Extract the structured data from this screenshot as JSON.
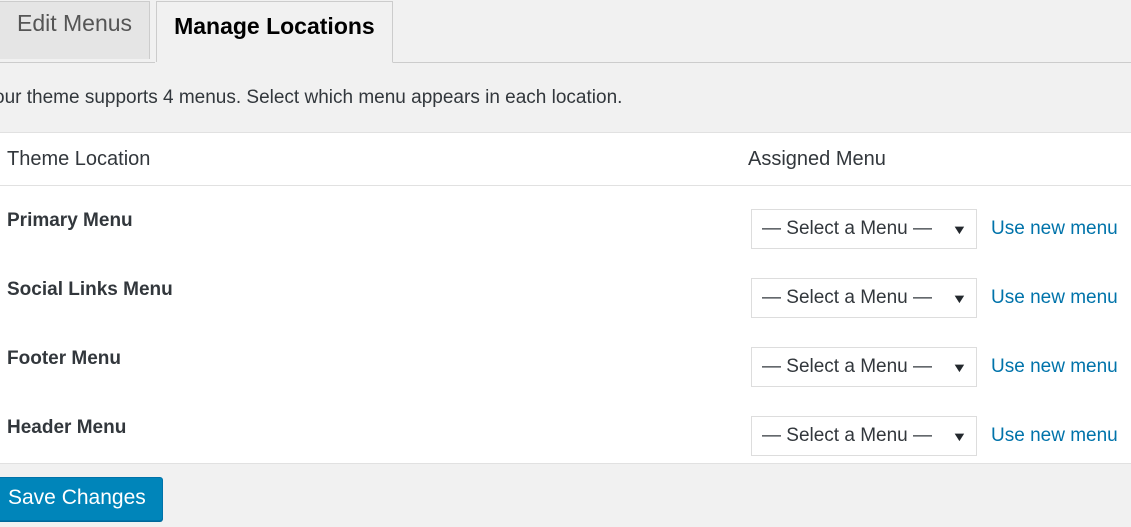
{
  "tabs": [
    {
      "label": "Edit Menus",
      "active": false
    },
    {
      "label": "Manage Locations",
      "active": true
    }
  ],
  "description": "our theme supports 4 menus. Select which menu appears in each location.",
  "table": {
    "headers": {
      "theme_location": "Theme Location",
      "assigned_menu": "Assigned Menu"
    },
    "rows": [
      {
        "location": "Primary Menu",
        "select_value": "— Select a Menu —",
        "caret": "▼",
        "link": "Use new menu"
      },
      {
        "location": "Social Links Menu",
        "select_value": "— Select a Menu —",
        "caret": "▼",
        "link": "Use new menu"
      },
      {
        "location": "Footer Menu",
        "select_value": "— Select a Menu —",
        "caret": "▼",
        "link": "Use new menu"
      },
      {
        "location": "Header Menu",
        "select_value": "— Select a Menu —",
        "caret": "▼",
        "link": "Use new menu"
      }
    ]
  },
  "footer": {
    "save_label": "Save Changes"
  },
  "colors": {
    "page_background": "#f1f1f1",
    "table_background": "#ffffff",
    "link_blue": "#0073aa",
    "primary_button": "#0085ba",
    "primary_button_border": "#0073aa",
    "text": "#32373c",
    "inactive_tab_background": "#e5e5e5",
    "inactive_tab_text": "#555555",
    "border": "#cccccc"
  }
}
